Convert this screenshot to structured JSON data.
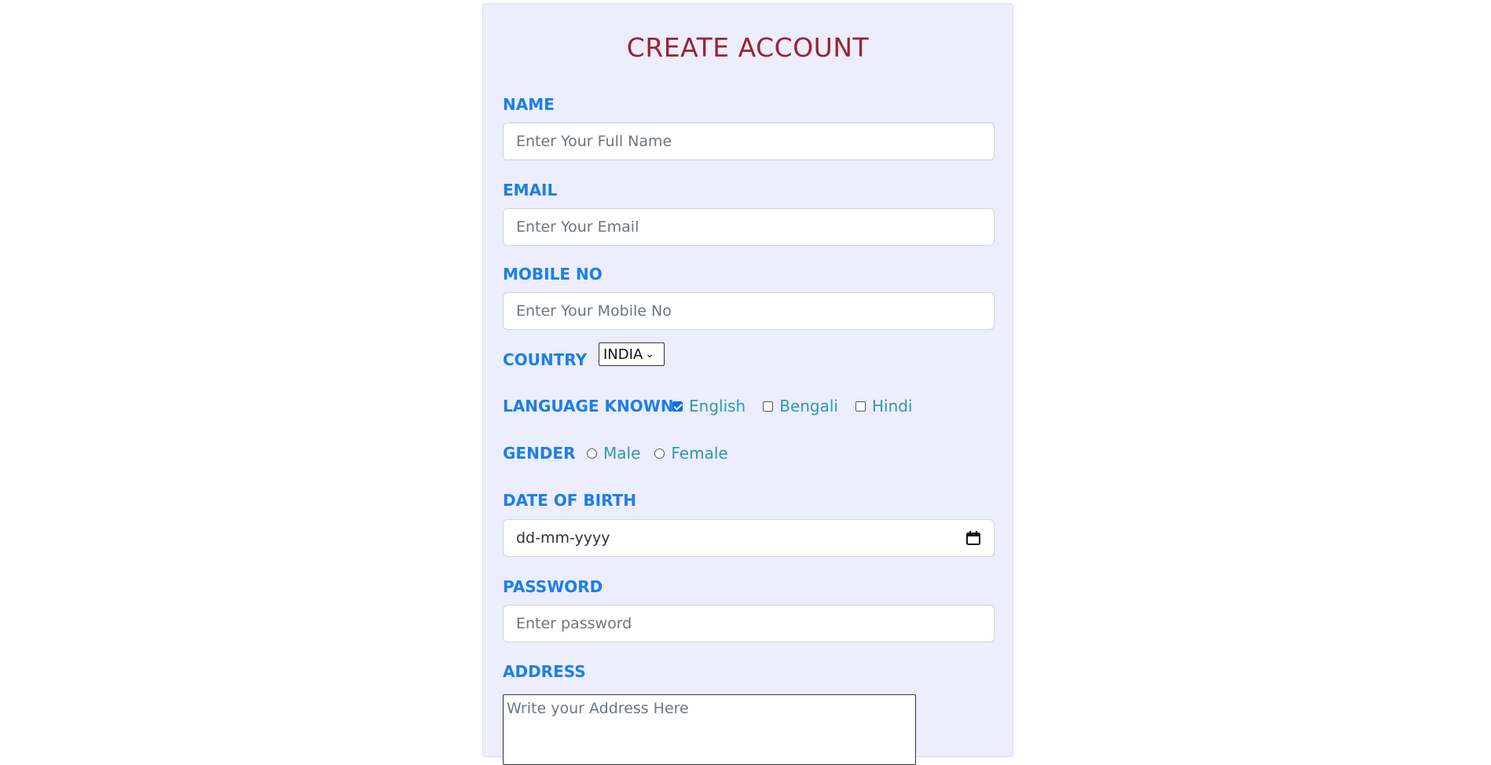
{
  "form": {
    "title": "CREATE ACCOUNT",
    "name": {
      "label": "NAME",
      "placeholder": "Enter Your Full Name"
    },
    "email": {
      "label": "EMAIL",
      "placeholder": "Enter Your Email"
    },
    "mobile": {
      "label": "MOBILE NO",
      "placeholder": "Enter Your Mobile No"
    },
    "country": {
      "label": "COUNTRY",
      "selected": "INDIA"
    },
    "languages": {
      "label": "LANGUAGE KNOWN",
      "options": [
        {
          "label": "English",
          "checked": true
        },
        {
          "label": "Bengali",
          "checked": false
        },
        {
          "label": "Hindi",
          "checked": false
        }
      ]
    },
    "gender": {
      "label": "GENDER",
      "options": [
        {
          "label": "Male",
          "selected": false
        },
        {
          "label": "Female",
          "selected": false
        }
      ]
    },
    "dob": {
      "label": "DATE OF BIRTH",
      "placeholder": "dd-mm-yyyy",
      "icon": "calendar-icon"
    },
    "password": {
      "label": "PASSWORD",
      "placeholder": "Enter password"
    },
    "address": {
      "label": "ADDRESS",
      "placeholder": "Write your Address Here"
    }
  },
  "colors": {
    "card_bg": "#ecedfd",
    "title": "#9b2231",
    "label": "#1c7fe7",
    "option_text": "#2a9aae"
  }
}
